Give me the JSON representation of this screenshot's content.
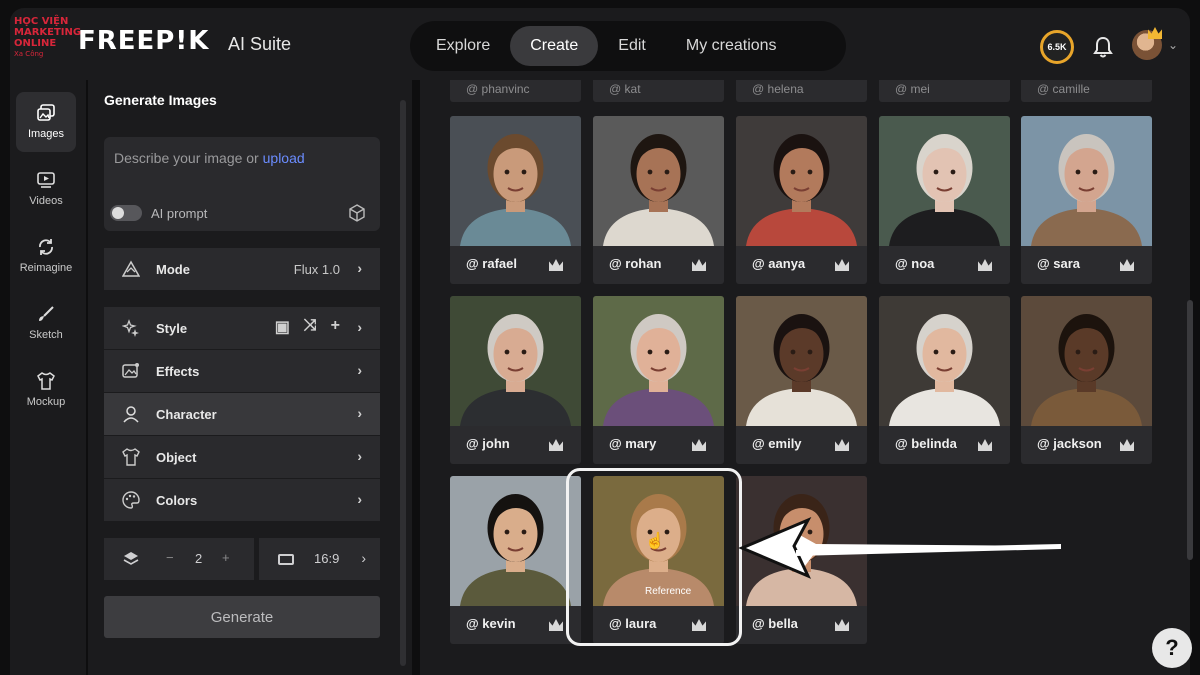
{
  "brand": {
    "watermark_line1": "HỌC VIỆN",
    "watermark_line2": "MARKETING ONLINE",
    "watermark_line3": "Xa Công",
    "logo": "FREEP!K",
    "suite": "AI Suite"
  },
  "nav": {
    "tabs": [
      "Explore",
      "Create",
      "Edit",
      "My creations"
    ],
    "active": "Create"
  },
  "header": {
    "credits": "6.5K",
    "accent_color": "#e8a52a"
  },
  "rail": {
    "items": [
      {
        "label": "Images",
        "icon": "images-icon"
      },
      {
        "label": "Videos",
        "icon": "videos-icon"
      },
      {
        "label": "Reimagine",
        "icon": "reimagine-icon"
      },
      {
        "label": "Sketch",
        "icon": "sketch-icon"
      },
      {
        "label": "Mockup",
        "icon": "mockup-icon"
      }
    ]
  },
  "panel": {
    "title": "Generate Images",
    "prompt_placeholder": "Describe your image or",
    "prompt_link": "upload",
    "ai_prompt_label": "AI prompt",
    "ai_prompt_on": false,
    "mode_label": "Mode",
    "mode_value": "Flux 1.0",
    "options": [
      "Style",
      "Effects",
      "Character",
      "Object",
      "Colors"
    ],
    "active_option": "Character",
    "count_minus": "−",
    "count": "2",
    "count_plus": "+",
    "ratio": "16:9",
    "generate_label": "Generate"
  },
  "gallery": {
    "partial_labels": [
      "@ phanvinc",
      "@ kat",
      "@ helena",
      "@ mei",
      "@ camille"
    ],
    "characters": [
      {
        "handle": "@ rafael",
        "skin": "#c99a7a",
        "hair": "#6b4a2e",
        "bg": "#4a4f55",
        "shirt": "#6a8a96"
      },
      {
        "handle": "@ rohan",
        "skin": "#a77356",
        "hair": "#1e1611",
        "bg": "#5a5a5a",
        "shirt": "#ddd8cf"
      },
      {
        "handle": "@ aanya",
        "skin": "#b27a5c",
        "hair": "#1a1210",
        "bg": "#3f3b3a",
        "shirt": "#b8483c"
      },
      {
        "handle": "@ noa",
        "skin": "#e2c3b3",
        "hair": "#d9d4cc",
        "bg": "#4a5a4e",
        "shirt": "#1d1d1f"
      },
      {
        "handle": "@ sara",
        "skin": "#d3a58f",
        "hair": "#c9c4be",
        "bg": "#7c94a6",
        "shirt": "#8a6a4f"
      },
      {
        "handle": "@ john",
        "skin": "#d8ab92",
        "hair": "#cfcac4",
        "bg": "#3f4a36",
        "shirt": "#2c2e31"
      },
      {
        "handle": "@ mary",
        "skin": "#e0b198",
        "hair": "#cfc9c3",
        "bg": "#5e6a48",
        "shirt": "#6b4f7a"
      },
      {
        "handle": "@ emily",
        "skin": "#5b3a29",
        "hair": "#1a1210",
        "bg": "#6a5a48",
        "shirt": "#e6e1d8"
      },
      {
        "handle": "@ belinda",
        "skin": "#e1b89f",
        "hair": "#d6d2cc",
        "bg": "#3e3a36",
        "shirt": "#e8e5e0"
      },
      {
        "handle": "@ jackson",
        "skin": "#5a3a28",
        "hair": "#1c130d",
        "bg": "#5c4a3b",
        "shirt": "#7a5a3a"
      },
      {
        "handle": "@ kevin",
        "skin": "#d9ad8b",
        "hair": "#151210",
        "bg": "#9aa2a8",
        "shirt": "#5b5a3c"
      },
      {
        "handle": "@ laura",
        "skin": "#dcae8a",
        "hair": "#a97a4a",
        "bg": "#7a6a3e",
        "shirt": "#b88a6a"
      },
      {
        "handle": "@ bella",
        "skin": "#c78e6c",
        "hair": "#3a2418",
        "bg": "#3a3030",
        "shirt": "#d6b7a4"
      }
    ],
    "reference_tag": "Reference",
    "highlighted": "@ laura"
  },
  "help_label": "?"
}
